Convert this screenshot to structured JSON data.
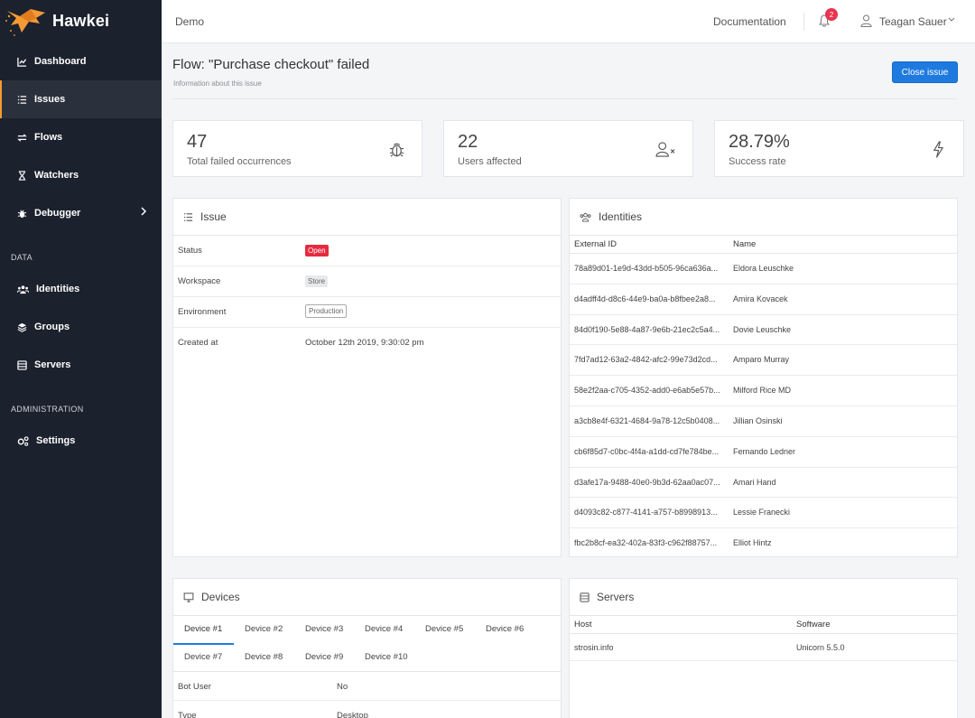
{
  "app": {
    "name": "Hawkei"
  },
  "sidebar": {
    "items": [
      {
        "label": "Dashboard",
        "icon": "chart-line-icon"
      },
      {
        "label": "Issues",
        "icon": "list-icon"
      },
      {
        "label": "Flows",
        "icon": "exchange-icon"
      },
      {
        "label": "Watchers",
        "icon": "hourglass-icon"
      },
      {
        "label": "Debugger",
        "icon": "bug-icon"
      }
    ],
    "data_section": "DATA",
    "data_items": [
      {
        "label": "Identities",
        "icon": "users-icon"
      },
      {
        "label": "Groups",
        "icon": "layers-icon"
      },
      {
        "label": "Servers",
        "icon": "server-icon"
      }
    ],
    "admin_section": "ADMINISTRATION",
    "admin_items": [
      {
        "label": "Settings",
        "icon": "gears-icon"
      }
    ]
  },
  "topbar": {
    "breadcrumb": "Demo",
    "documentation": "Documentation",
    "notification_count": "2",
    "user_name": "Teagan Sauer"
  },
  "header": {
    "title": "Flow: \"Purchase checkout\" failed",
    "subtitle": "Information about this issue",
    "close_button": "Close issue"
  },
  "stats": [
    {
      "value": "47",
      "label": "Total failed occurrences"
    },
    {
      "value": "22",
      "label": "Users affected"
    },
    {
      "value": "28.79%",
      "label": "Success rate"
    }
  ],
  "issue": {
    "title": "Issue",
    "rows": [
      {
        "key": "Status",
        "value": "Open"
      },
      {
        "key": "Workspace",
        "value": "Store"
      },
      {
        "key": "Environment",
        "value": "Production"
      },
      {
        "key": "Created at",
        "value": "October 12th 2019, 9:30:02 pm"
      }
    ]
  },
  "identities": {
    "title": "Identities",
    "columns": [
      "External ID",
      "Name"
    ],
    "rows": [
      [
        "78a89d01-1e9d-43dd-b505-96ca636a...",
        "Eldora Leuschke"
      ],
      [
        "d4adff4d-d8c6-44e9-ba0a-b8fbee2a8...",
        "Amira Kovacek"
      ],
      [
        "84d0f190-5e88-4a87-9e6b-21ec2c5a4...",
        "Dovie Leuschke"
      ],
      [
        "7fd7ad12-63a2-4842-afc2-99e73d2cd...",
        "Amparo Murray"
      ],
      [
        "58e2f2aa-c705-4352-add0-e6ab5e57b...",
        "Milford Rice MD"
      ],
      [
        "a3cb8e4f-6321-4684-9a78-12c5b0408...",
        "Jillian Osinski"
      ],
      [
        "cb6f85d7-c0bc-4f4a-a1dd-cd7fe784be...",
        "Fernando Ledner"
      ],
      [
        "d3afe17a-9488-40e0-9b3d-62aa0ac07...",
        "Amari Hand"
      ],
      [
        "d4093c82-c877-4141-a757-b8998913...",
        "Lessie Franecki"
      ],
      [
        "fbc2b8cf-ea32-402a-83f3-c962f88757...",
        "Elliot Hintz"
      ]
    ]
  },
  "devices": {
    "title": "Devices",
    "tabs": [
      "Device #1",
      "Device #2",
      "Device #3",
      "Device #4",
      "Device #5",
      "Device #6",
      "Device #7",
      "Device #8",
      "Device #9",
      "Device #10"
    ],
    "rows": [
      {
        "key": "Bot User",
        "value": "No"
      },
      {
        "key": "Type",
        "value": "Desktop"
      }
    ]
  },
  "servers": {
    "title": "Servers",
    "columns": [
      "Host",
      "Software"
    ],
    "rows": [
      [
        "strosin.info",
        "Unicorn 5.5.0"
      ]
    ]
  },
  "colors": {
    "sidebar_bg": "#1b212d",
    "accent_orange": "#f49a35",
    "primary_blue": "#1f7ae0",
    "danger_red": "#e52a3f"
  }
}
